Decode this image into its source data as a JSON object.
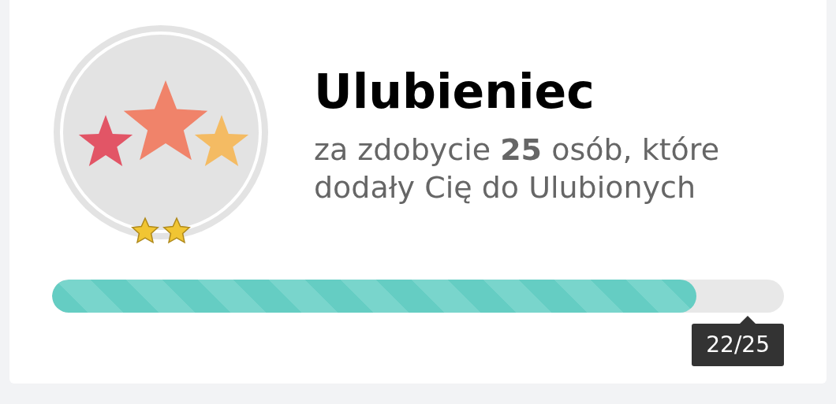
{
  "badge": {
    "title": "Ulubieniec",
    "description": "za zdobycie **25** osób, które dodały Cię do Ulubionych"
  },
  "progress": {
    "level": 0.88,
    "reading": "22/25"
  }
}
